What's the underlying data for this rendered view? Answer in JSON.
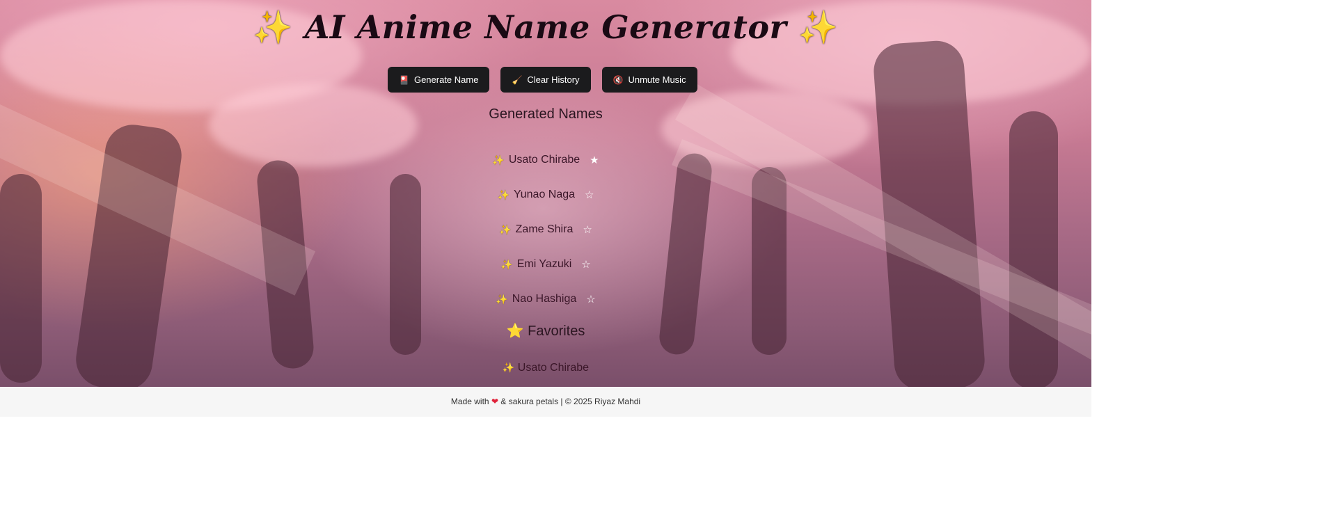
{
  "header": {
    "title": "AI Anime Name Generator",
    "sparkle_left": "✨",
    "sparkle_right": "✨"
  },
  "toolbar": {
    "generate_label": "Generate Name",
    "generate_icon": "🎴",
    "clear_label": "Clear History",
    "clear_icon": "🧹",
    "unmute_label": "Unmute Music",
    "unmute_icon": "🔇"
  },
  "generated": {
    "title": "Generated Names",
    "items": [
      {
        "name": "Usato Chirabe",
        "favorited": true
      },
      {
        "name": "Yunao Naga",
        "favorited": false
      },
      {
        "name": "Zame Shira",
        "favorited": false
      },
      {
        "name": "Emi Yazuki",
        "favorited": false
      },
      {
        "name": "Nao Hashiga",
        "favorited": false
      }
    ]
  },
  "favorites": {
    "icon": "⭐",
    "title": "Favorites",
    "items": [
      "Usato Chirabe"
    ]
  },
  "footer": {
    "prefix": "Made with",
    "heart": "❤",
    "suffix": "& sakura petals | © 2025 Riyaz Mahdi"
  },
  "icons": {
    "sparkle": "sparkle-icon",
    "star_filled": "★",
    "star_empty": "☆"
  }
}
